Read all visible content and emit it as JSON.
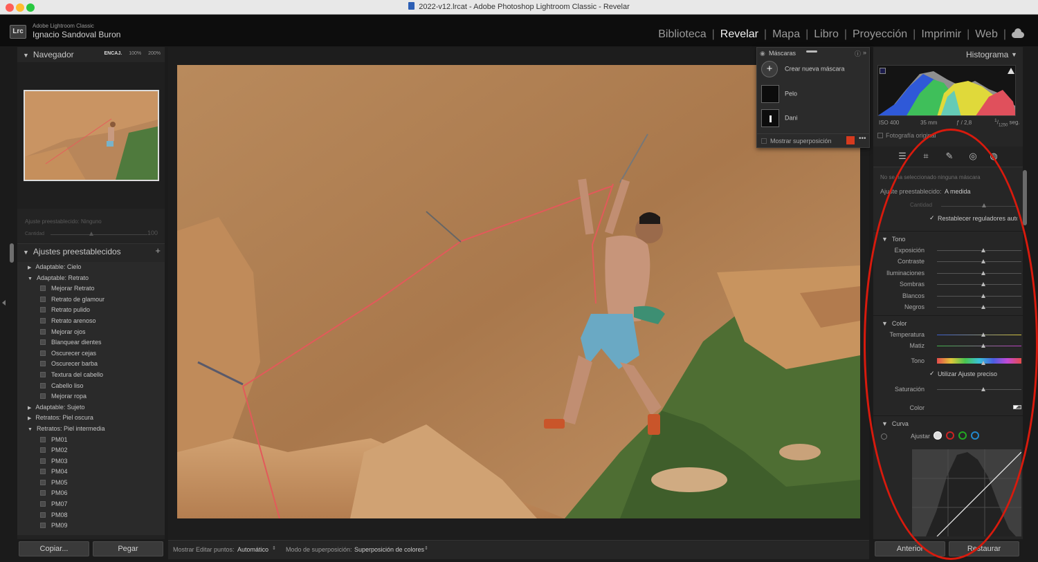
{
  "window": {
    "title": "2022-v12.lrcat - Adobe Photoshop Lightroom Classic - Revelar"
  },
  "header": {
    "app_name": "Adobe Lightroom Classic",
    "user_name": "Ignacio Sandoval Buron",
    "logo_text": "Lrc",
    "modules": [
      {
        "label": "Biblioteca",
        "active": false
      },
      {
        "label": "Revelar",
        "active": true
      },
      {
        "label": "Mapa",
        "active": false
      },
      {
        "label": "Libro",
        "active": false
      },
      {
        "label": "Proyección",
        "active": false
      },
      {
        "label": "Imprimir",
        "active": false
      },
      {
        "label": "Web",
        "active": false
      }
    ],
    "cloud_icon": "cloud-icon"
  },
  "navigator": {
    "title": "Navegador",
    "fit": "ENCAJ.",
    "zoom1": "100%",
    "zoom2": "200%"
  },
  "quick_preset": {
    "label": "Ajuste preestablecido: Ninguno",
    "amount_label": "Cantidad",
    "amount_value": "100"
  },
  "presets": {
    "title": "Ajustes preestablecidos",
    "add": "+",
    "items": [
      {
        "label": "Adaptable: Cielo",
        "type": "group",
        "open": false
      },
      {
        "label": "Adaptable: Retrato",
        "type": "group",
        "open": true
      },
      {
        "label": "Mejorar Retrato",
        "type": "item"
      },
      {
        "label": "Retrato de glamour",
        "type": "item"
      },
      {
        "label": "Retrato pulido",
        "type": "item"
      },
      {
        "label": "Retrato arenoso",
        "type": "item"
      },
      {
        "label": "Mejorar ojos",
        "type": "item"
      },
      {
        "label": "Blanquear dientes",
        "type": "item"
      },
      {
        "label": "Oscurecer cejas",
        "type": "item"
      },
      {
        "label": "Oscurecer barba",
        "type": "item"
      },
      {
        "label": "Textura del cabello",
        "type": "item"
      },
      {
        "label": "Cabello liso",
        "type": "item"
      },
      {
        "label": "Mejorar ropa",
        "type": "item"
      },
      {
        "label": "Adaptable: Sujeto",
        "type": "group",
        "open": false
      },
      {
        "label": "Retratos: Piel oscura",
        "type": "group",
        "open": false
      },
      {
        "label": "Retratos: Piel intermedia",
        "type": "group",
        "open": true
      },
      {
        "label": "PM01",
        "type": "item"
      },
      {
        "label": "PM02",
        "type": "item"
      },
      {
        "label": "PM03",
        "type": "item"
      },
      {
        "label": "PM04",
        "type": "item"
      },
      {
        "label": "PM05",
        "type": "item"
      },
      {
        "label": "PM06",
        "type": "item"
      },
      {
        "label": "PM07",
        "type": "item"
      },
      {
        "label": "PM08",
        "type": "item"
      },
      {
        "label": "PM09",
        "type": "item"
      }
    ]
  },
  "left_buttons": {
    "copy": "Copiar...",
    "paste": "Pegar"
  },
  "toolbar": {
    "edit_points_label": "Mostrar Editar puntos:",
    "edit_points_value": "Automático",
    "overlay_mode_label": "Modo de superposición:",
    "overlay_mode_value": "Superposición de colores"
  },
  "masks": {
    "title": "Máscaras",
    "create": "Crear nueva máscara",
    "items": [
      "Pelo",
      "Dani"
    ],
    "show_overlay": "Mostrar superposición",
    "overlay_color": "#d63a1e"
  },
  "histogram": {
    "title": "Histograma",
    "iso": "ISO 400",
    "focal": "35 mm",
    "aperture": "ƒ / 2,8",
    "shutter_num": "1",
    "shutter_den": "1250",
    "shutter_unit": "seg.",
    "original": "Fotografía original"
  },
  "mask_panel": {
    "no_mask": "No se ha seleccionado ninguna máscara",
    "preset_label": "Ajuste preestablecido:",
    "preset_value": "A medida",
    "amount": "Cantidad",
    "reset_auto": "Restablecer reguladores automáticamente"
  },
  "tone": {
    "title": "Tono",
    "sliders": [
      "Exposición",
      "Contraste",
      "Iluminaciones",
      "Sombras",
      "Blancos",
      "Negros"
    ]
  },
  "color": {
    "title": "Color",
    "sliders": [
      "Temperatura",
      "Matiz"
    ],
    "hue": "Tono",
    "fine": "Utilizar Ajuste preciso",
    "saturation": "Saturación",
    "color_label": "Color"
  },
  "curve": {
    "title": "Curva",
    "adjust": "Ajustar"
  },
  "right_buttons": {
    "previous": "Anterior",
    "reset": "Restaurar"
  },
  "annotation": {
    "color": "#d81a0d"
  }
}
